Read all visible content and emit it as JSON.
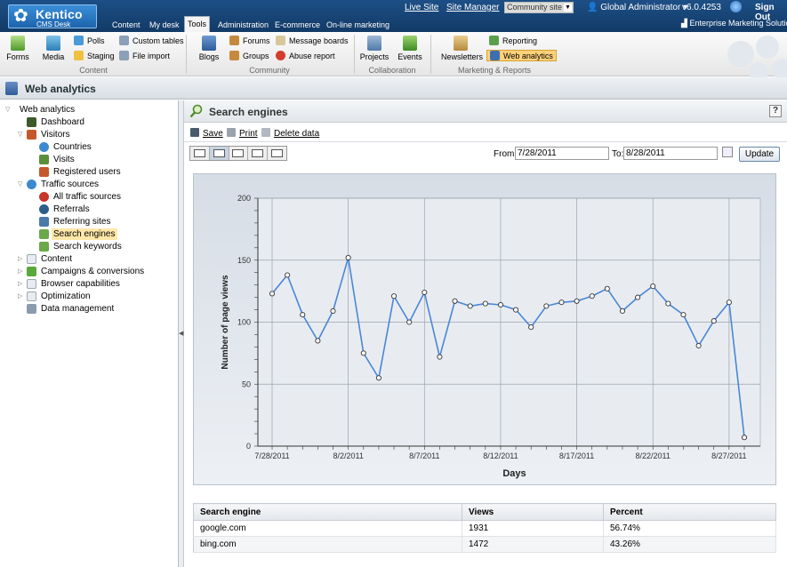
{
  "header": {
    "logo_name": "Kentico",
    "logo_sub": "CMS Desk",
    "live_site": "Live Site",
    "site_manager": "Site Manager",
    "site_selector": "Community site",
    "user": "Global Administrator",
    "version": "v6.0.4253",
    "sign_out": "Sign Out",
    "product": "Enterprise Marketing Solution",
    "tabs": [
      "Content",
      "My desk",
      "Tools",
      "Administration",
      "E-commerce",
      "On-line marketing"
    ],
    "active_tab": "Tools"
  },
  "ribbon": {
    "forms": "Forms",
    "media": "Media",
    "polls": "Polls",
    "staging": "Staging",
    "custom_tables": "Custom tables",
    "file_import": "File import",
    "group_content": "Content",
    "blogs": "Blogs",
    "forums": "Forums",
    "groups": "Groups",
    "message_boards": "Message boards",
    "abuse_report": "Abuse report",
    "group_community": "Community",
    "projects": "Projects",
    "events": "Events",
    "group_collaboration": "Collaboration",
    "newsletters": "Newsletters",
    "reporting": "Reporting",
    "web_analytics": "Web analytics",
    "group_marketing": "Marketing & Reports"
  },
  "page_title": "Web analytics",
  "tree": {
    "root": "Web analytics",
    "dashboard": "Dashboard",
    "visitors": "Visitors",
    "countries": "Countries",
    "visits": "Visits",
    "registered_users": "Registered users",
    "traffic_sources": "Traffic sources",
    "all_traffic_sources": "All traffic sources",
    "referrals": "Referrals",
    "referring_sites": "Referring sites",
    "search_engines": "Search engines",
    "search_keywords": "Search keywords",
    "content": "Content",
    "campaigns": "Campaigns & conversions",
    "browser_capabilities": "Browser capabilities",
    "optimization": "Optimization",
    "data_management": "Data management"
  },
  "content": {
    "title": "Search engines",
    "save": "Save",
    "print": "Print",
    "delete_data": "Delete data",
    "from_label": "From:",
    "from_value": "7/28/2011",
    "to_label": "To:",
    "to_value": "8/28/2011",
    "update": "Update"
  },
  "chart_data": {
    "type": "line",
    "title": "",
    "xlabel": "Days",
    "ylabel": "Number of page views",
    "ylim": [
      0,
      200
    ],
    "yticks": [
      0,
      50,
      100,
      150,
      200
    ],
    "xtick_labels": [
      "7/28/2011",
      "8/2/2011",
      "8/7/2011",
      "8/12/2011",
      "8/17/2011",
      "8/22/2011",
      "8/27/2011"
    ],
    "x": [
      "7/28/2011",
      "7/29/2011",
      "7/30/2011",
      "7/31/2011",
      "8/1/2011",
      "8/2/2011",
      "8/3/2011",
      "8/4/2011",
      "8/5/2011",
      "8/6/2011",
      "8/7/2011",
      "8/8/2011",
      "8/9/2011",
      "8/10/2011",
      "8/11/2011",
      "8/12/2011",
      "8/13/2011",
      "8/14/2011",
      "8/15/2011",
      "8/16/2011",
      "8/17/2011",
      "8/18/2011",
      "8/19/2011",
      "8/20/2011",
      "8/21/2011",
      "8/22/2011",
      "8/23/2011",
      "8/24/2011",
      "8/25/2011",
      "8/26/2011",
      "8/27/2011",
      "8/28/2011"
    ],
    "values": [
      123,
      138,
      106,
      85,
      109,
      152,
      75,
      55,
      121,
      100,
      124,
      72,
      117,
      113,
      115,
      114,
      110,
      96,
      113,
      116,
      117,
      121,
      127,
      109,
      120,
      129,
      115,
      106,
      81,
      101,
      116,
      7
    ],
    "grid": true,
    "color": "#4a86d6"
  },
  "table": {
    "headers": [
      "Search engine",
      "Views",
      "Percent"
    ],
    "rows": [
      [
        "google.com",
        "1931",
        "56.74%"
      ],
      [
        "bing.com",
        "1472",
        "43.26%"
      ]
    ]
  }
}
